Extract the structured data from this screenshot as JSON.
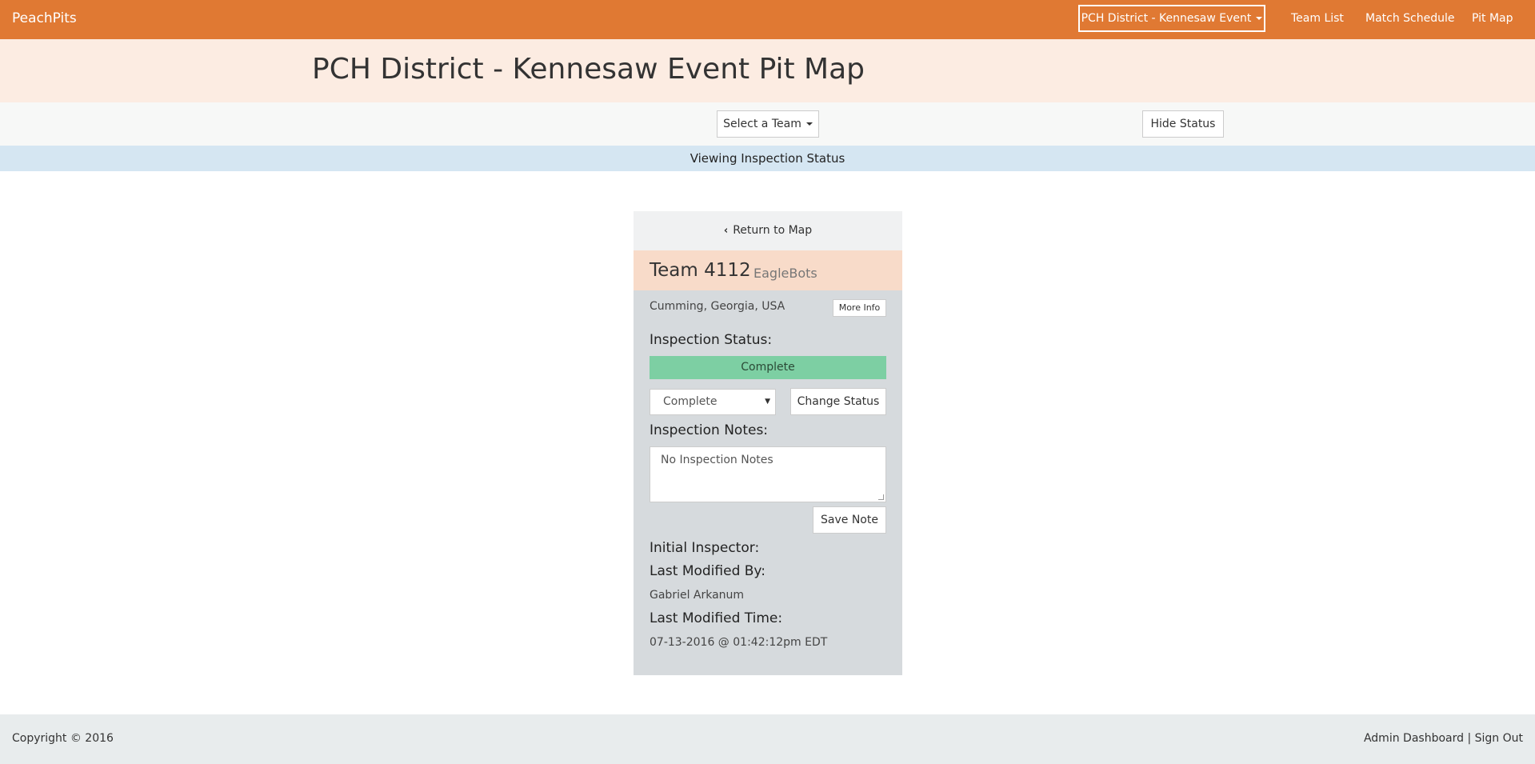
{
  "navbar": {
    "brand": "PeachPits",
    "event_selector": "PCH District - Kennesaw Event",
    "links": [
      "Team List",
      "Match Schedule",
      "Pit Map"
    ]
  },
  "header": {
    "title": "PCH District - Kennesaw Event Pit Map"
  },
  "toolbar": {
    "select_team": "Select a Team",
    "hide_status": "Hide Status"
  },
  "status_banner": "Viewing Inspection Status",
  "team_panel": {
    "return_label": "Return to Map",
    "team_number": "Team 4112",
    "team_name": "EagleBots",
    "location": "Cumming, Georgia, USA",
    "more_info": "More Info",
    "inspection_status_label": "Inspection Status:",
    "status_value": "Complete",
    "status_select_value": "Complete",
    "change_status": "Change Status",
    "inspection_notes_label": "Inspection Notes:",
    "notes_value": "No Inspection Notes",
    "save_note": "Save Note",
    "initial_inspector_label": "Initial Inspector:",
    "last_modified_by_label": "Last Modified By:",
    "last_modified_by": "Gabriel Arkanum",
    "last_modified_time_label": "Last Modified Time:",
    "last_modified_time": "07-13-2016 @ 01:42:12pm EDT"
  },
  "footer": {
    "copyright": "Copyright © 2016",
    "admin_dashboard": "Admin Dashboard",
    "separator": "|",
    "sign_out": "Sign Out"
  },
  "colors": {
    "navbar": "#e07933",
    "title_band": "#fcece2",
    "banner": "#d5e6f2",
    "panel": "#d6dadd",
    "team_header": "#f8dbc9",
    "status_complete": "#7dcfa3"
  }
}
